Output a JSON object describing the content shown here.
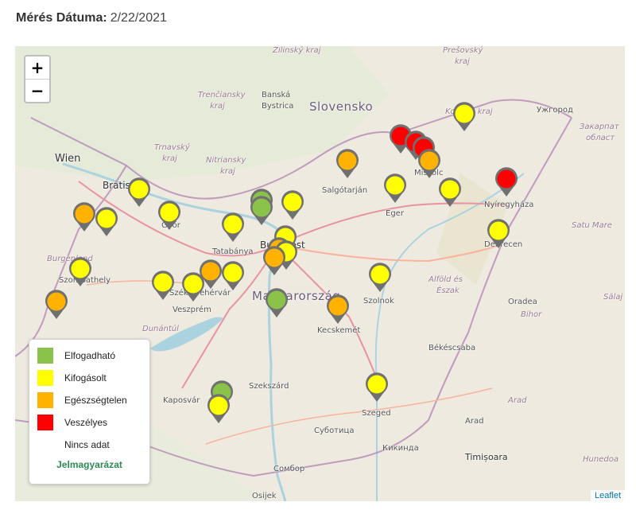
{
  "header": {
    "date_label": "Mérés Dátuma:",
    "date_value": "2/22/2021"
  },
  "map": {
    "zoom_in": "+",
    "zoom_out": "−",
    "attribution": "Leaflet",
    "labels": {
      "country_sk": "Slovensko",
      "country_hu": "Magyarország",
      "wien": "Wien",
      "bratislava": "Bratislava",
      "banska": "Banská",
      "bystrica": "Bystrica",
      "zilinsky": "Žilinský kraj",
      "trenciansky": "Trenčiansky",
      "kraj1": "kraj",
      "trnavsky": "Trnavský",
      "kraj2": "kraj",
      "nitriansky": "Nitriansky",
      "kraj3": "kraj",
      "presovsky": "Prešovský",
      "kraj4": "kraj",
      "kosicky": "Košický kraj",
      "uzhorod": "Ужгород",
      "zakarpatska": "Закарпат",
      "oblast": "област",
      "salgotarjan": "Salgótarján",
      "eger": "Eger",
      "miskolc": "Miskolc",
      "nyiregyhaza": "Nyíregyháza",
      "debrecen": "Debrecen",
      "satu_mare": "Satu Mare",
      "budapest": "Budapest",
      "tatabanya": "Tatabánya",
      "gyor": "Győr",
      "szombathely": "Szombathely",
      "burgenland": "Burgenland",
      "szekesfehervar": "Székesfehérvár",
      "veszprem": "Veszprém",
      "dunantul": "Dunántúl",
      "szolnok": "Szolnok",
      "alfold1": "Alföld és",
      "alfold2": "Észak",
      "kecskemet": "Kecskemét",
      "oradea": "Oradea",
      "bihor": "Bihor",
      "bekescsaba": "Békéscsaba",
      "szekszard": "Szekszárd",
      "kaposvar": "Kaposvár",
      "szeged": "Szeged",
      "arad1": "Arad",
      "arad2": "Arad",
      "subotica": "Суботица",
      "kikinda": "Кикинда",
      "timisoara": "Timișoara",
      "sombor": "Сомбор",
      "osijek": "Osijek",
      "salaj": "Sălaj",
      "hunedoara": "Hunedoa"
    }
  },
  "legend": {
    "title": "Jelmagyarázat",
    "items": [
      {
        "label": "Elfogadható",
        "color": "#8bc34a"
      },
      {
        "label": "Kifogásolt",
        "color": "#ffff00"
      },
      {
        "label": "Egészségtelen",
        "color": "#ffb300"
      },
      {
        "label": "Veszélyes",
        "color": "#ff0000"
      },
      {
        "label": "Nincs adat",
        "color": "#ffffff"
      }
    ]
  },
  "colors": {
    "good": "#8bc34a",
    "moderate": "#ffff00",
    "unhealthy": "#ffb300",
    "dangerous": "#ff0000",
    "marker_border": "#707070"
  },
  "stations": [
    {
      "id": "s1",
      "status": "dangerous"
    },
    {
      "id": "s2",
      "status": "dangerous"
    },
    {
      "id": "s3",
      "status": "dangerous"
    },
    {
      "id": "s4",
      "status": "moderate"
    },
    {
      "id": "s5",
      "status": "unhealthy"
    },
    {
      "id": "s6",
      "status": "unhealthy"
    },
    {
      "id": "s7",
      "status": "moderate"
    },
    {
      "id": "s8",
      "status": "moderate"
    },
    {
      "id": "s9",
      "status": "dangerous"
    },
    {
      "id": "s10",
      "status": "moderate"
    },
    {
      "id": "s11",
      "status": "moderate"
    },
    {
      "id": "s12",
      "status": "unhealthy"
    },
    {
      "id": "s13",
      "status": "moderate"
    },
    {
      "id": "s14",
      "status": "moderate"
    },
    {
      "id": "s15",
      "status": "good"
    },
    {
      "id": "s16",
      "status": "good"
    },
    {
      "id": "s17",
      "status": "moderate"
    },
    {
      "id": "s18",
      "status": "moderate"
    },
    {
      "id": "s19",
      "status": "moderate"
    },
    {
      "id": "s20",
      "status": "unhealthy"
    },
    {
      "id": "s21",
      "status": "moderate"
    },
    {
      "id": "s22",
      "status": "unhealthy"
    },
    {
      "id": "s23",
      "status": "moderate"
    },
    {
      "id": "s24",
      "status": "unhealthy"
    },
    {
      "id": "s25",
      "status": "moderate"
    },
    {
      "id": "s26",
      "status": "moderate"
    },
    {
      "id": "s27",
      "status": "moderate"
    },
    {
      "id": "s28",
      "status": "good"
    },
    {
      "id": "s29",
      "status": "unhealthy"
    },
    {
      "id": "s30",
      "status": "unhealthy"
    },
    {
      "id": "s31",
      "status": "moderate"
    },
    {
      "id": "s32",
      "status": "moderate"
    },
    {
      "id": "s33",
      "status": "good"
    },
    {
      "id": "s34",
      "status": "moderate"
    }
  ]
}
